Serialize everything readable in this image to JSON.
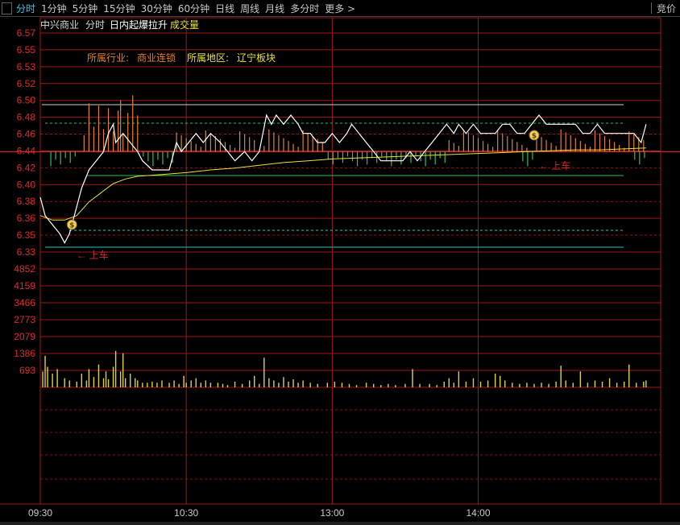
{
  "tabs": [
    {
      "label": "分时",
      "active": true
    },
    {
      "label": "1分钟"
    },
    {
      "label": "5分钟"
    },
    {
      "label": "15分钟"
    },
    {
      "label": "30分钟"
    },
    {
      "label": "60分钟"
    },
    {
      "label": "日线"
    },
    {
      "label": "周线"
    },
    {
      "label": "月线"
    },
    {
      "label": "多分时"
    },
    {
      "label": "更多 >"
    }
  ],
  "right_tab": "竞价",
  "header": {
    "stock_name": "中兴商业",
    "mode": "分时",
    "indicator": "日内起爆拉升",
    "volume_label": "成交量",
    "industry_label": "所属行业:",
    "industry_value": "商业连锁",
    "region_label": "所属地区:",
    "region_value": "辽宁板块"
  },
  "signal_label": "上车",
  "colors": {
    "grid": "#a01818",
    "price": "#ffffff",
    "avg": "#e8e040",
    "tick": "#e02828",
    "vol_tick": "#e02828",
    "time": "#c8c8c8",
    "signal_up": "#e08030",
    "signal_down": "#30c050",
    "volume": "#e0d040",
    "header_name": "#d8d8d8",
    "header_label": "#e08030",
    "header_region": "#e8e040"
  },
  "chart_data": {
    "type": "line",
    "price_axis_ticks": [
      "6.57",
      "6.55",
      "6.53",
      "6.52",
      "6.50",
      "6.48",
      "6.46",
      "6.44",
      "6.42",
      "6.40",
      "6.38",
      "6.36",
      "6.35",
      "6.33"
    ],
    "volume_axis_ticks": [
      "4852",
      "4159",
      "3466",
      "2773",
      "2079",
      "1386",
      "693"
    ],
    "time_ticks": [
      "09:30",
      "10:30",
      "13:00",
      "14:00"
    ],
    "ylim": [
      6.33,
      6.57
    ],
    "prev_close": 6.44,
    "x_range_minutes": [
      0,
      255
    ],
    "price_series": [
      [
        0,
        6.39
      ],
      [
        2,
        6.37
      ],
      [
        5,
        6.36
      ],
      [
        8,
        6.35
      ],
      [
        10,
        6.34
      ],
      [
        12,
        6.35
      ],
      [
        14,
        6.37
      ],
      [
        17,
        6.4
      ],
      [
        20,
        6.42
      ],
      [
        23,
        6.43
      ],
      [
        26,
        6.44
      ],
      [
        28,
        6.46
      ],
      [
        30,
        6.47
      ],
      [
        31,
        6.45
      ],
      [
        34,
        6.46
      ],
      [
        37,
        6.45
      ],
      [
        40,
        6.44
      ],
      [
        42,
        6.43
      ],
      [
        46,
        6.42
      ],
      [
        50,
        6.42
      ],
      [
        53,
        6.42
      ],
      [
        56,
        6.45
      ],
      [
        58,
        6.44
      ],
      [
        61,
        6.45
      ],
      [
        64,
        6.46
      ],
      [
        67,
        6.45
      ],
      [
        70,
        6.46
      ],
      [
        74,
        6.45
      ],
      [
        77,
        6.44
      ],
      [
        80,
        6.43
      ],
      [
        84,
        6.44
      ],
      [
        87,
        6.43
      ],
      [
        90,
        6.44
      ],
      [
        93,
        6.48
      ],
      [
        95,
        6.47
      ],
      [
        97,
        6.48
      ],
      [
        100,
        6.47
      ],
      [
        103,
        6.48
      ],
      [
        106,
        6.47
      ],
      [
        108,
        6.46
      ],
      [
        111,
        6.46
      ],
      [
        114,
        6.45
      ],
      [
        117,
        6.45
      ],
      [
        120,
        6.46
      ],
      [
        123,
        6.45
      ],
      [
        126,
        6.46
      ],
      [
        128,
        6.47
      ],
      [
        131,
        6.46
      ],
      [
        134,
        6.45
      ],
      [
        137,
        6.44
      ],
      [
        140,
        6.43
      ],
      [
        143,
        6.43
      ],
      [
        146,
        6.43
      ],
      [
        149,
        6.43
      ],
      [
        152,
        6.44
      ],
      [
        155,
        6.43
      ],
      [
        158,
        6.44
      ],
      [
        161,
        6.45
      ],
      [
        164,
        6.46
      ],
      [
        167,
        6.47
      ],
      [
        170,
        6.46
      ],
      [
        172,
        6.47
      ],
      [
        175,
        6.46
      ],
      [
        178,
        6.47
      ],
      [
        181,
        6.46
      ],
      [
        184,
        6.46
      ],
      [
        187,
        6.46
      ],
      [
        190,
        6.47
      ],
      [
        193,
        6.47
      ],
      [
        196,
        6.46
      ],
      [
        199,
        6.46
      ],
      [
        202,
        6.47
      ],
      [
        205,
        6.48
      ],
      [
        208,
        6.47
      ],
      [
        211,
        6.47
      ],
      [
        214,
        6.47
      ],
      [
        217,
        6.47
      ],
      [
        220,
        6.47
      ],
      [
        223,
        6.46
      ],
      [
        226,
        6.46
      ],
      [
        229,
        6.47
      ],
      [
        232,
        6.46
      ],
      [
        235,
        6.46
      ],
      [
        238,
        6.46
      ],
      [
        241,
        6.46
      ],
      [
        244,
        6.46
      ],
      [
        247,
        6.45
      ],
      [
        249,
        6.47
      ]
    ],
    "avg_series": [
      [
        0,
        6.37
      ],
      [
        5,
        6.365
      ],
      [
        10,
        6.365
      ],
      [
        15,
        6.37
      ],
      [
        20,
        6.385
      ],
      [
        25,
        6.395
      ],
      [
        30,
        6.405
      ],
      [
        35,
        6.41
      ],
      [
        40,
        6.413
      ],
      [
        50,
        6.415
      ],
      [
        60,
        6.417
      ],
      [
        70,
        6.42
      ],
      [
        80,
        6.422
      ],
      [
        90,
        6.425
      ],
      [
        100,
        6.428
      ],
      [
        110,
        6.43
      ],
      [
        120,
        6.432
      ],
      [
        130,
        6.433
      ],
      [
        140,
        6.434
      ],
      [
        150,
        6.435
      ],
      [
        160,
        6.436
      ],
      [
        170,
        6.437
      ],
      [
        180,
        6.438
      ],
      [
        190,
        6.439
      ],
      [
        200,
        6.44
      ],
      [
        210,
        6.441
      ],
      [
        220,
        6.442
      ],
      [
        230,
        6.442
      ],
      [
        240,
        6.443
      ],
      [
        249,
        6.444
      ]
    ],
    "signal_points": [
      [
        13,
        6.36
      ],
      [
        203,
        6.458
      ]
    ],
    "volume_bars": [
      [
        1,
        693
      ],
      [
        2,
        1386
      ],
      [
        3,
        900
      ],
      [
        5,
        600
      ],
      [
        7,
        800
      ],
      [
        10,
        400
      ],
      [
        12,
        300
      ],
      [
        15,
        250
      ],
      [
        17,
        600
      ],
      [
        19,
        300
      ],
      [
        20,
        800
      ],
      [
        22,
        450
      ],
      [
        24,
        1000
      ],
      [
        26,
        400
      ],
      [
        27,
        700
      ],
      [
        28,
        350
      ],
      [
        30,
        900
      ],
      [
        31,
        1600
      ],
      [
        33,
        700
      ],
      [
        34,
        1500
      ],
      [
        35,
        400
      ],
      [
        37,
        600
      ],
      [
        39,
        400
      ],
      [
        40,
        300
      ],
      [
        42,
        200
      ],
      [
        44,
        200
      ],
      [
        46,
        250
      ],
      [
        48,
        200
      ],
      [
        50,
        300
      ],
      [
        53,
        200
      ],
      [
        55,
        300
      ],
      [
        57,
        150
      ],
      [
        59,
        500
      ],
      [
        60,
        200
      ],
      [
        62,
        300
      ],
      [
        64,
        400
      ],
      [
        66,
        200
      ],
      [
        68,
        300
      ],
      [
        70,
        200
      ],
      [
        73,
        200
      ],
      [
        75,
        150
      ],
      [
        77,
        100
      ],
      [
        80,
        250
      ],
      [
        83,
        150
      ],
      [
        86,
        300
      ],
      [
        88,
        500
      ],
      [
        90,
        150
      ],
      [
        92,
        1300
      ],
      [
        94,
        400
      ],
      [
        96,
        300
      ],
      [
        98,
        200
      ],
      [
        100,
        450
      ],
      [
        102,
        250
      ],
      [
        104,
        350
      ],
      [
        106,
        200
      ],
      [
        108,
        300
      ],
      [
        111,
        200
      ],
      [
        114,
        150
      ],
      [
        118,
        200
      ],
      [
        121,
        250
      ],
      [
        124,
        200
      ],
      [
        127,
        150
      ],
      [
        130,
        100
      ],
      [
        134,
        200
      ],
      [
        137,
        150
      ],
      [
        140,
        100
      ],
      [
        143,
        150
      ],
      [
        146,
        100
      ],
      [
        150,
        150
      ],
      [
        153,
        800
      ],
      [
        156,
        150
      ],
      [
        160,
        150
      ],
      [
        163,
        100
      ],
      [
        166,
        250
      ],
      [
        168,
        400
      ],
      [
        170,
        200
      ],
      [
        172,
        700
      ],
      [
        175,
        250
      ],
      [
        178,
        400
      ],
      [
        181,
        250
      ],
      [
        184,
        300
      ],
      [
        187,
        600
      ],
      [
        189,
        500
      ],
      [
        191,
        300
      ],
      [
        194,
        200
      ],
      [
        197,
        150
      ],
      [
        200,
        200
      ],
      [
        203,
        150
      ],
      [
        206,
        200
      ],
      [
        209,
        150
      ],
      [
        212,
        250
      ],
      [
        214,
        950
      ],
      [
        216,
        300
      ],
      [
        219,
        200
      ],
      [
        222,
        700
      ],
      [
        225,
        200
      ],
      [
        228,
        300
      ],
      [
        231,
        250
      ],
      [
        234,
        400
      ],
      [
        237,
        200
      ],
      [
        240,
        250
      ],
      [
        242,
        1000
      ],
      [
        245,
        200
      ],
      [
        248,
        250
      ],
      [
        249,
        300
      ]
    ],
    "up_ticks": [
      18,
      20,
      22,
      24,
      26,
      28,
      30,
      32,
      33,
      34,
      36,
      38,
      40,
      56,
      58,
      60,
      62,
      64,
      66,
      68,
      70,
      72,
      74,
      76,
      78,
      80,
      82,
      84,
      86,
      88,
      92,
      94,
      96,
      98,
      100,
      102,
      104,
      106,
      108,
      110,
      112,
      114,
      116,
      168,
      170,
      172,
      174,
      176,
      178,
      180,
      182,
      184,
      186,
      188,
      190,
      192,
      194,
      196,
      198,
      200,
      204,
      206,
      208,
      210,
      212,
      214,
      216,
      218,
      220,
      222,
      224,
      226,
      228,
      230,
      232,
      234,
      236,
      238,
      240,
      242,
      244,
      246,
      248
    ],
    "down_ticks": [
      4,
      6,
      8,
      10,
      12,
      14,
      42,
      44,
      46,
      48,
      50,
      52,
      54,
      118,
      120,
      122,
      124,
      126,
      128,
      130,
      132,
      134,
      136,
      138,
      140,
      142,
      144,
      146,
      148,
      150,
      152,
      154,
      156,
      158,
      160,
      162,
      164,
      166,
      198,
      200,
      202,
      244,
      246,
      248
    ]
  }
}
